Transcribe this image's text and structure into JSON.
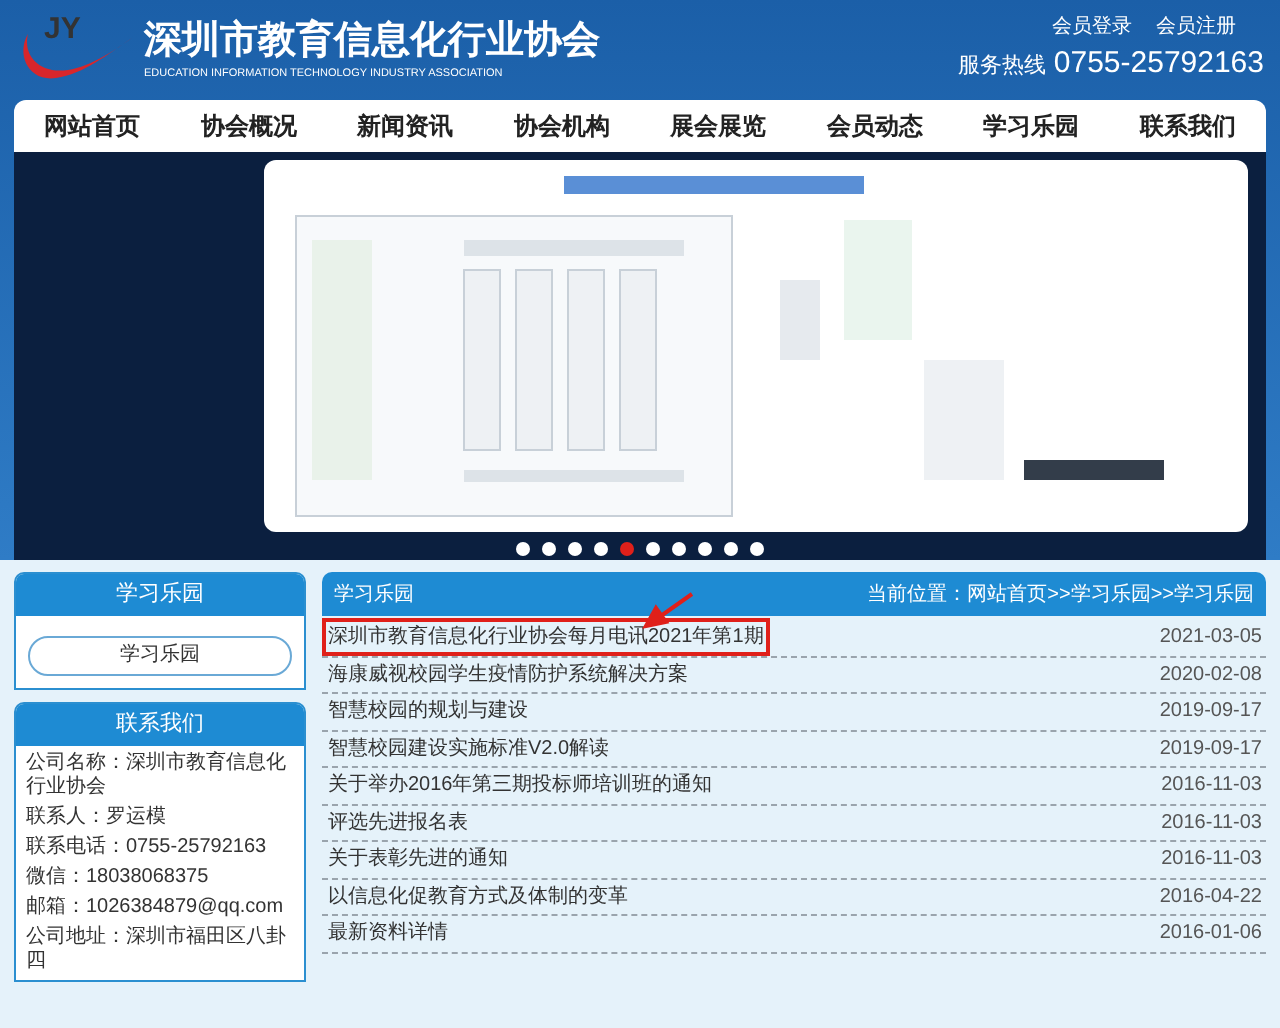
{
  "header": {
    "logo_text": "JY",
    "title": "深圳市教育信息化行业协会",
    "subtitle": "EDUCATION INFORMATION TECHNOLOGY INDUSTRY ASSOCIATION",
    "links": [
      "会员登录",
      "会员注册"
    ],
    "hotline_label": "服务热线",
    "hotline": "0755-25792163"
  },
  "nav": [
    {
      "label": "网站首页",
      "selected": false
    },
    {
      "label": "协会概况",
      "selected": false
    },
    {
      "label": "新闻资讯",
      "selected": false
    },
    {
      "label": "协会机构",
      "selected": false
    },
    {
      "label": "展会展览",
      "selected": false
    },
    {
      "label": "会员动态",
      "selected": false
    },
    {
      "label": "学习乐园",
      "selected": false
    },
    {
      "label": "联系我们",
      "selected": false
    }
  ],
  "banner": {
    "kind": "picture",
    "dots": [
      {
        "selected": false
      },
      {
        "selected": false
      },
      {
        "selected": false
      },
      {
        "selected": false
      },
      {
        "selected": true
      },
      {
        "selected": false
      },
      {
        "selected": false
      },
      {
        "selected": false
      },
      {
        "selected": false
      },
      {
        "selected": false
      }
    ]
  },
  "sidebar": {
    "section_title": "学习乐园",
    "section_button": "学习乐园",
    "contact_title": "联系我们",
    "contact_lines": [
      "公司名称：深圳市教育信息化行业协会",
      "联系人：罗运模",
      "联系电话：0755-25792163",
      "微信：18038068375",
      "邮箱：1026384879@qq.com",
      "公司地址：深圳市福田区八卦四"
    ]
  },
  "main": {
    "title": "学习乐园",
    "breadcrumb": "当前位置：网站首页>>学习乐园>>学习乐园",
    "articles": [
      {
        "title": "深圳市教育信息化行业协会每月电讯2021年第1期",
        "date": "2021-03-05",
        "highlighted": true
      },
      {
        "title": "海康威视校园学生疫情防护系统解决方案",
        "date": "2020-02-08",
        "highlighted": false
      },
      {
        "title": "智慧校园的规划与建设",
        "date": "2019-09-17",
        "highlighted": false
      },
      {
        "title": "智慧校园建设实施标准V2.0解读",
        "date": "2019-09-17",
        "highlighted": false
      },
      {
        "title": "关于举办2016年第三期投标师培训班的通知",
        "date": "2016-11-03",
        "highlighted": false
      },
      {
        "title": "评选先进报名表",
        "date": "2016-11-03",
        "highlighted": false
      },
      {
        "title": "关于表彰先进的通知",
        "date": "2016-11-03",
        "highlighted": false
      },
      {
        "title": "以信息化促教育方式及体制的变革",
        "date": "2016-04-22",
        "highlighted": false
      },
      {
        "title": "最新资料详情",
        "date": "2016-01-06",
        "highlighted": false
      }
    ]
  }
}
